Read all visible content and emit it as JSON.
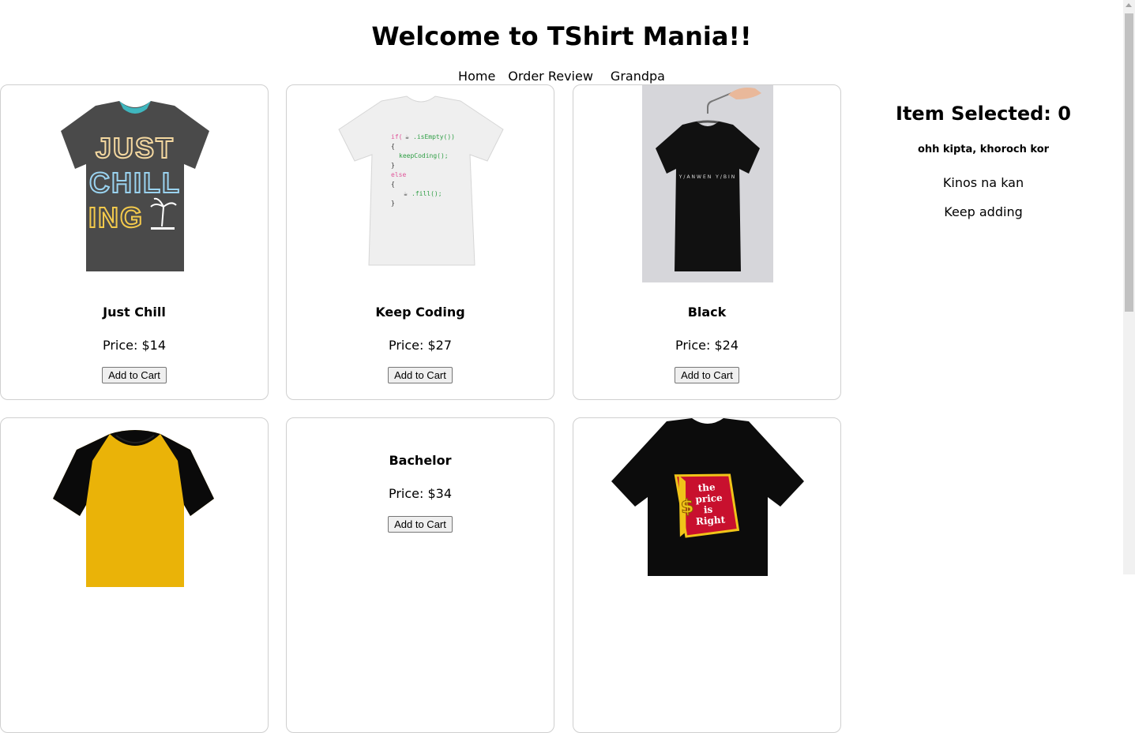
{
  "header": {
    "title": "Welcome to TShirt Mania!!"
  },
  "nav": {
    "items": [
      "Home",
      "Order Review",
      "Grandpa"
    ]
  },
  "products": [
    {
      "name": "Just Chill",
      "price": "Price: $14",
      "button": "Add to Cart",
      "shirt_color": "#4a4a4a",
      "print_text": "JUST CHILL ING"
    },
    {
      "name": "Keep Coding",
      "price": "Price: $27",
      "button": "Add to Cart",
      "shirt_color": "#f2f2f2",
      "print_text": "if(☕.isEmpty()) { keepCoding(); } else { ☕.fill(); }"
    },
    {
      "name": "Black",
      "price": "Price: $24",
      "button": "Add to Cart",
      "shirt_color": "#111111",
      "print_text": ""
    },
    {
      "name": "",
      "price": "",
      "button": "",
      "shirt_color": "#eab308",
      "print_text": ""
    },
    {
      "name": "Bachelor",
      "price": "Price: $34",
      "button": "Add to Cart",
      "shirt_color": "",
      "print_text": ""
    },
    {
      "name": "",
      "price": "",
      "button": "",
      "shirt_color": "#111111",
      "print_text": "the price is right"
    }
  ],
  "sidebar": {
    "title": "Item Selected: 0",
    "line1": "ohh kipta, khoroch kor",
    "line2": "Kinos na kan",
    "line3": "Keep adding"
  }
}
